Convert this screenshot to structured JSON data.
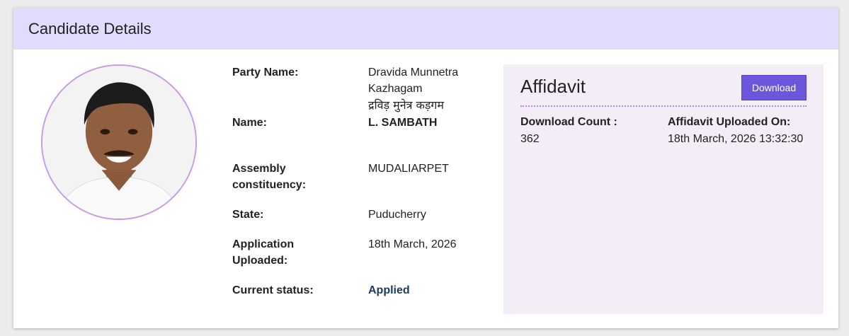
{
  "header": {
    "title": "Candidate Details"
  },
  "colors": {
    "header_bg": "#e0dcfd",
    "button": "#6c56dc",
    "panel_bg": "#f3edf7",
    "status": "#1b3a5f",
    "photo_border": "#c79ae2"
  },
  "details": {
    "party_label": "Party Name:",
    "party_value_en_1": "Dravida Munnetra",
    "party_value_en_2": "Kazhagam",
    "party_value_hi": "द्रविड़ मुनेत्र कड़गम",
    "name_label": "Name:",
    "name_value": "L. SAMBATH",
    "constituency_label_1": "Assembly",
    "constituency_label_2": "constituency:",
    "constituency_value": "MUDALIARPET",
    "state_label": "State:",
    "state_value": "Puducherry",
    "application_label_1": "Application",
    "application_label_2": "Uploaded:",
    "application_value": "18th March, 2026",
    "status_label": "Current status:",
    "status_value": "Applied"
  },
  "affidavit": {
    "title": "Affidavit",
    "download_label": "Download",
    "count_label": "Download Count :",
    "count_value": "362",
    "uploaded_label": "Affidavit Uploaded On:",
    "uploaded_value": "18th March, 2026 13:32:30"
  }
}
